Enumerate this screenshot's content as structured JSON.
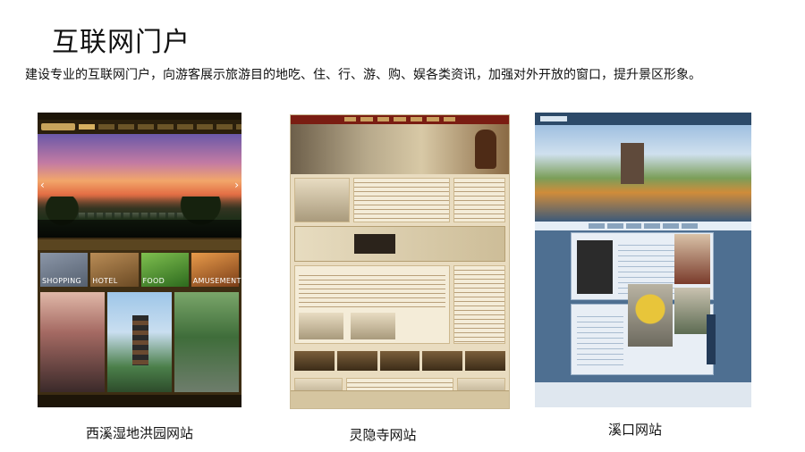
{
  "page": {
    "title": "互联网门户",
    "subtitle": "建设专业的互联网门户，向游客展示旅游目的地吃、住、行、游、购、娱各类资讯，加强对外开放的窗口，提升景区形象。"
  },
  "sites": [
    {
      "caption": "西溪湿地洪园网站",
      "tiles": [
        "SHOPPING",
        "HOTEL",
        "FOOD",
        "AMUSEMENT"
      ]
    },
    {
      "caption": "灵隐寺网站"
    },
    {
      "caption": "溪口网站"
    }
  ]
}
